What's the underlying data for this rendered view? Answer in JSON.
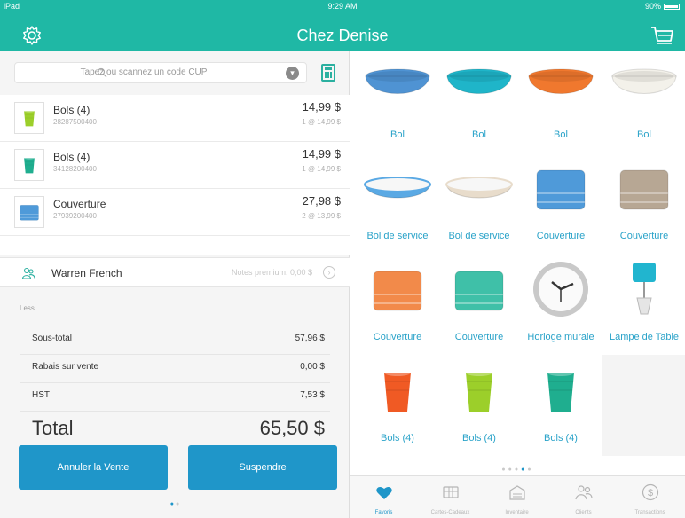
{
  "status_bar": {
    "device": "iPad",
    "time": "9:29 AM",
    "battery": "90%"
  },
  "header": {
    "title": "Chez Denise",
    "settings_icon": "gear-icon",
    "cart_icon": "cart-icon"
  },
  "search": {
    "placeholder": "Tapez ou scannez un code CUP"
  },
  "cart_items": [
    {
      "name": "Bols (4)",
      "sku": "28287500400",
      "price": "14,99 $",
      "unit": "1 @ 14,99 $",
      "thumb_color": "#9ccf2a"
    },
    {
      "name": "Bols (4)",
      "sku": "34128200400",
      "price": "14,99 $",
      "unit": "1 @ 14,99 $",
      "thumb_color": "#1fae8f"
    },
    {
      "name": "Couverture",
      "sku": "27939200400",
      "price": "27,98 $",
      "unit": "2 @ 13,99 $",
      "thumb_color": "#4f9ad9"
    }
  ],
  "customer": {
    "name": "Warren French",
    "points": "Notes premium: 0,00 $"
  },
  "section_label": "Less",
  "totals": {
    "subtotal_label": "Sous-total",
    "subtotal": "57,96 $",
    "discount_label": "Rabais sur vente",
    "discount": "0,00 $",
    "tax_label": "HST",
    "tax": "7,53 $",
    "total_label": "Total",
    "total": "65,50 $"
  },
  "buttons": {
    "cancel": "Annuler la Vente",
    "suspend": "Suspendre"
  },
  "products": [
    {
      "label": "Bol",
      "kind": "bowl",
      "color": "#4f93d3"
    },
    {
      "label": "Bol",
      "kind": "bowl",
      "color": "#1fb5c9"
    },
    {
      "label": "Bol",
      "kind": "bowl",
      "color": "#f0782e"
    },
    {
      "label": "Bol",
      "kind": "bowl",
      "color": "#f3f1ea"
    },
    {
      "label": "Bol de service",
      "kind": "dish",
      "color": "#5aa9e4"
    },
    {
      "label": "Bol de service",
      "kind": "dish",
      "color": "#e8dccb"
    },
    {
      "label": "Couverture",
      "kind": "blanket",
      "color": "#4f9ad9"
    },
    {
      "label": "Couverture",
      "kind": "blanket",
      "color": "#b7a794"
    },
    {
      "label": "Couverture",
      "kind": "blanket",
      "color": "#f28a4a"
    },
    {
      "label": "Couverture",
      "kind": "blanket",
      "color": "#3fc0a8"
    },
    {
      "label": "Horloge murale",
      "kind": "clock",
      "color": "#c9c9c9"
    },
    {
      "label": "Lampe de Table",
      "kind": "lamp",
      "color": "#21b5cf"
    },
    {
      "label": "Bols (4)",
      "kind": "cups",
      "color": "#f05a24"
    },
    {
      "label": "Bols (4)",
      "kind": "cups",
      "color": "#9ccf2a"
    },
    {
      "label": "Bols (4)",
      "kind": "cups",
      "color": "#1fae8f"
    },
    {
      "label": "",
      "kind": "empty",
      "color": "#f4f4f4"
    }
  ],
  "tabs": [
    {
      "label": "Favoris",
      "icon": "heart-icon",
      "active": true
    },
    {
      "label": "Cartes-Cadeaux",
      "icon": "gift-card-icon",
      "active": false
    },
    {
      "label": "Inventaire",
      "icon": "warehouse-icon",
      "active": false
    },
    {
      "label": "Clients",
      "icon": "clients-icon",
      "active": false
    },
    {
      "label": "Transactions",
      "icon": "dollar-icon",
      "active": false
    }
  ],
  "colors": {
    "teal": "#1fb8a5",
    "blue": "#1f96c9",
    "link": "#2aa3c9"
  }
}
